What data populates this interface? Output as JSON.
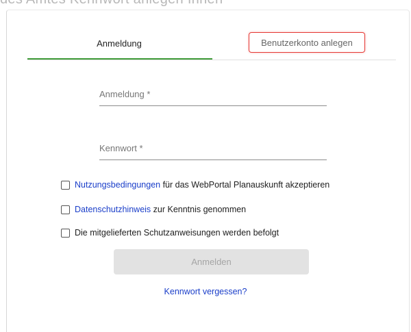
{
  "top_crop_text": "des Amtes Kennwort anlegen Ihnen",
  "tabs": [
    {
      "label": "Anmeldung"
    },
    {
      "label": "Benutzerkonto anlegen"
    }
  ],
  "fields": {
    "login": {
      "label": "Anmeldung *",
      "value": ""
    },
    "password": {
      "label": "Kennwort *",
      "value": ""
    }
  },
  "checkboxes": {
    "terms": {
      "link": "Nutzungsbedingungen",
      "text": " für das WebPortal Planauskunft akzeptieren",
      "checked": false
    },
    "privacy": {
      "link": "Datenschutzhinweis",
      "text": " zur Kenntnis genommen",
      "checked": false
    },
    "safety": {
      "text": "Die mitgelieferten Schutzanweisungen werden befolgt",
      "checked": false
    }
  },
  "submit_label": "Anmelden",
  "forgot_label": "Kennwort vergessen?",
  "colors": {
    "active_tab_underline": "#3e9b38",
    "highlight_border": "#e53935",
    "link": "#1a3ec9",
    "disabled_button_bg": "#e2e2e2"
  }
}
